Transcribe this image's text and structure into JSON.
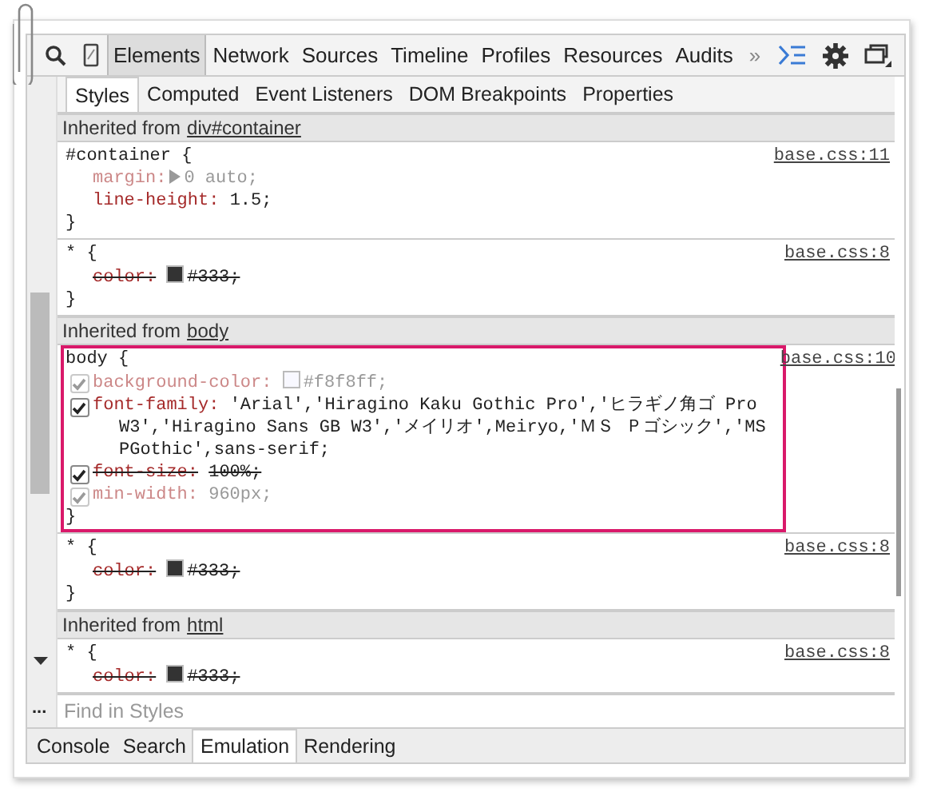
{
  "toolbar": {
    "tabs": [
      {
        "label": "Elements",
        "selected": true
      },
      {
        "label": "Network",
        "selected": false
      },
      {
        "label": "Sources",
        "selected": false
      },
      {
        "label": "Timeline",
        "selected": false
      },
      {
        "label": "Profiles",
        "selected": false
      },
      {
        "label": "Resources",
        "selected": false
      },
      {
        "label": "Audits",
        "selected": false
      }
    ],
    "overflow": "»"
  },
  "subtabs": [
    {
      "label": "Styles",
      "selected": true
    },
    {
      "label": "Computed",
      "selected": false
    },
    {
      "label": "Event Listeners",
      "selected": false
    },
    {
      "label": "DOM Breakpoints",
      "selected": false
    },
    {
      "label": "Properties",
      "selected": false
    }
  ],
  "sections": [
    {
      "kind": "inherited",
      "prefix": "Inherited from",
      "link": "div#container"
    },
    {
      "kind": "rule",
      "selector": "#container {",
      "source": "base.css:11",
      "highlighted": false,
      "close": "}",
      "properties": [
        {
          "name": "margin:",
          "value": "0 auto;",
          "expandable": true,
          "inactive": true,
          "overridden": false
        },
        {
          "name": "line-height:",
          "value": "1.5;",
          "expandable": false,
          "inactive": false,
          "overridden": false
        }
      ]
    },
    {
      "kind": "rule",
      "selector": "* {",
      "source": "base.css:8",
      "highlighted": false,
      "close": "}",
      "properties": [
        {
          "name": "color:",
          "value": "#333;",
          "swatch": true,
          "expandable": false,
          "inactive": false,
          "overridden": true
        }
      ]
    },
    {
      "kind": "inherited",
      "prefix": "Inherited from",
      "link": "body"
    },
    {
      "kind": "rule",
      "selector": "body {",
      "source": "base.css:10",
      "highlighted": true,
      "close": "}",
      "properties": [
        {
          "name": "background-color:",
          "value": "#f8f8ff;",
          "swatch": true,
          "expandable": false,
          "inactive": true,
          "overridden": false,
          "checked": true
        },
        {
          "name": "font-family:",
          "value": "'Arial','Hiragino Kaku Gothic Pro','ヒラギノ角ゴ Pro W3','Hiragino Sans GB W3','メイリオ',Meiryo,'ＭＳ Ｐゴシック','MS PGothic',sans-serif;",
          "expandable": false,
          "inactive": false,
          "overridden": false,
          "checked": true
        },
        {
          "name": "font-size:",
          "value": "100%;",
          "expandable": false,
          "inactive": false,
          "overridden": true,
          "checked": true
        },
        {
          "name": "min-width:",
          "value": "960px;",
          "expandable": false,
          "inactive": true,
          "overridden": false,
          "checked": true
        }
      ]
    },
    {
      "kind": "rule",
      "selector": "* {",
      "source": "base.css:8",
      "highlighted": false,
      "close": "}",
      "properties": [
        {
          "name": "color:",
          "value": "#333;",
          "swatch": true,
          "expandable": false,
          "inactive": false,
          "overridden": true
        }
      ]
    },
    {
      "kind": "inherited",
      "prefix": "Inherited from",
      "link": "html"
    },
    {
      "kind": "rule",
      "selector": "* {",
      "source": "base.css:8",
      "highlighted": false,
      "properties": [
        {
          "name": "color:",
          "value": "#333;",
          "swatch": true,
          "expandable": false,
          "inactive": false,
          "overridden": true
        }
      ]
    }
  ],
  "filter": {
    "placeholder": "Find in Styles",
    "more": "..."
  },
  "drawer_tabs": [
    {
      "label": "Console",
      "selected": false
    },
    {
      "label": "Search",
      "selected": false
    },
    {
      "label": "Emulation",
      "selected": true
    },
    {
      "label": "Rendering",
      "selected": false
    }
  ]
}
